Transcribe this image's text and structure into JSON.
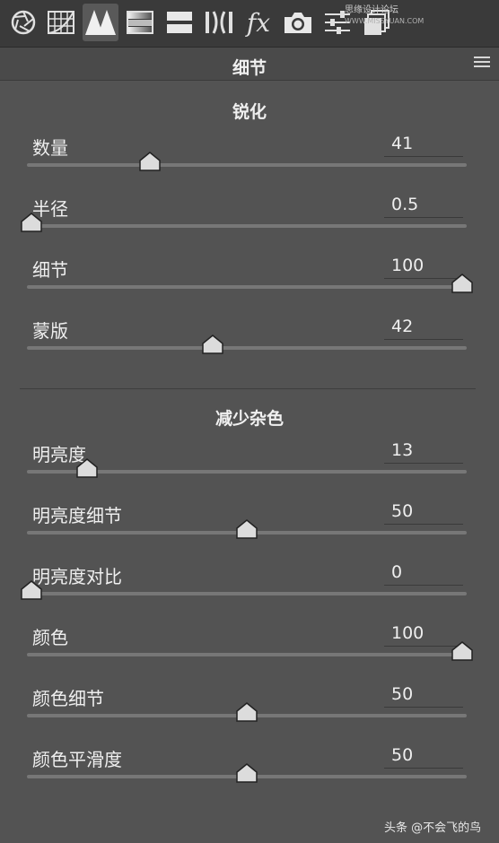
{
  "toolbar": {
    "tools": [
      {
        "icon": "aperture-icon"
      },
      {
        "icon": "tone-curve-grid-icon"
      },
      {
        "icon": "detail-triangles-icon",
        "active": true
      },
      {
        "icon": "hsl-gradient-icon"
      },
      {
        "icon": "split-toning-icon"
      },
      {
        "icon": "lens-correction-icon"
      },
      {
        "icon": "fx-icon",
        "text": "fx"
      },
      {
        "icon": "camera-icon"
      },
      {
        "icon": "sliders-icon"
      },
      {
        "icon": "presets-stack-icon"
      }
    ],
    "watermark": "思缘设计论坛",
    "watermark_url": "WWW.MISSYUAN.COM"
  },
  "panel": {
    "title": "细节"
  },
  "sharpening": {
    "title": "锐化",
    "rows": [
      {
        "label": "数量",
        "value": "41",
        "fraction": 0.274
      },
      {
        "label": "半径",
        "value": "0.5",
        "fraction": 0.0
      },
      {
        "label": "细节",
        "value": "100",
        "fraction": 1.0
      },
      {
        "label": "蒙版",
        "value": "42",
        "fraction": 0.42
      }
    ]
  },
  "noise": {
    "title": "减少杂色",
    "rows": [
      {
        "label": "明亮度",
        "value": "13",
        "fraction": 0.13
      },
      {
        "label": "明亮度细节",
        "value": "50",
        "fraction": 0.5
      },
      {
        "label": "明亮度对比",
        "value": "0",
        "fraction": 0.0
      },
      {
        "label": "颜色",
        "value": "100",
        "fraction": 1.0
      },
      {
        "label": "颜色细节",
        "value": "50",
        "fraction": 0.5
      },
      {
        "label": "颜色平滑度",
        "value": "50",
        "fraction": 0.5
      }
    ]
  },
  "footer": "头条 @不会飞的鸟"
}
